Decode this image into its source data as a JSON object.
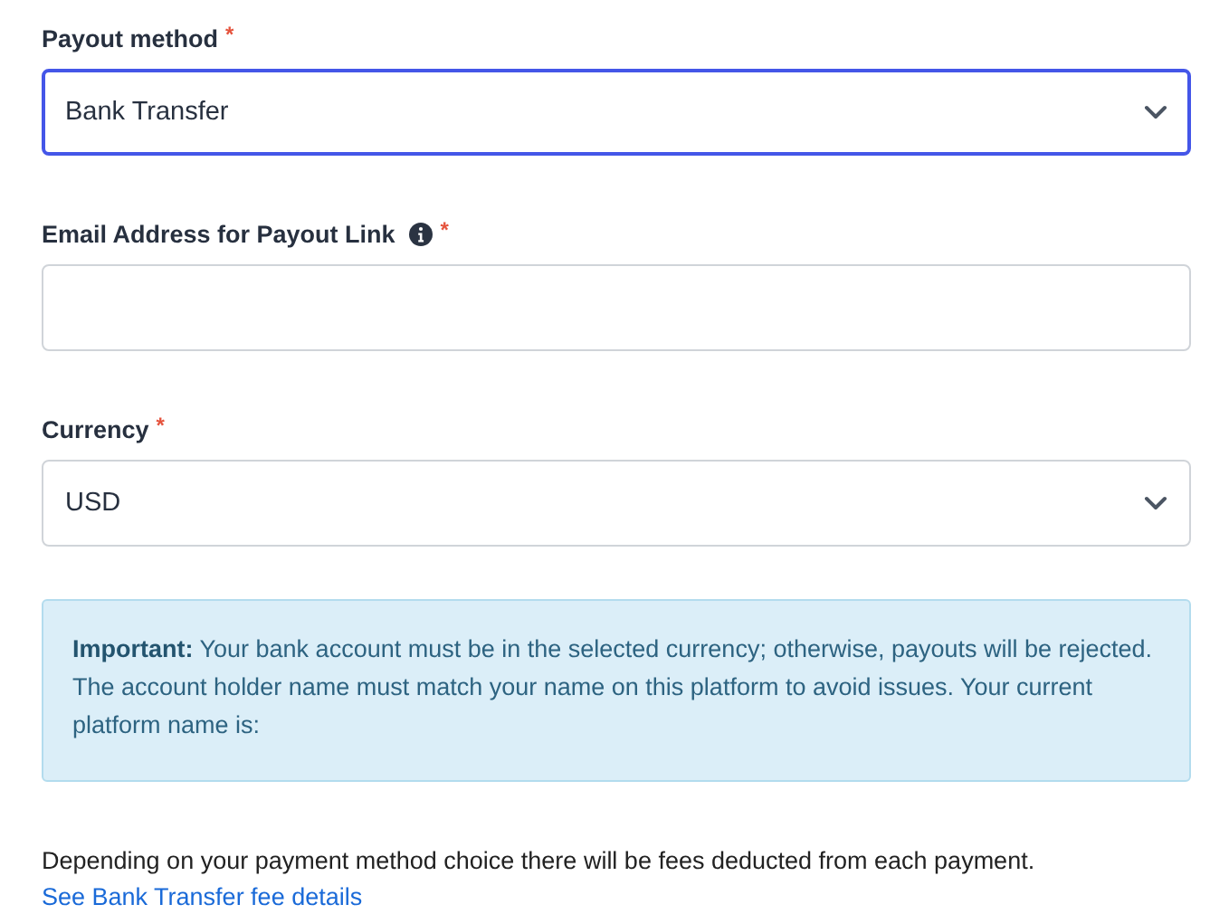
{
  "fields": [
    {
      "kind": "select",
      "label": "Payout method",
      "required_mark": "*",
      "info": false,
      "value": "Bank Transfer",
      "focused": true
    },
    {
      "kind": "text",
      "label": "Email Address for Payout Link",
      "required_mark": "*",
      "info": true,
      "focused": false
    },
    {
      "kind": "select",
      "label": "Currency",
      "required_mark": "*",
      "info": false,
      "value": "USD",
      "focused": false
    }
  ],
  "notice": {
    "text": "**Important:** Your bank account must be in the selected currency; otherwise, payouts will be rejected. The account holder name must match your name on this platform to avoid issues. Your current platform name is:"
  },
  "fees": {
    "text": "Depending on your payment method choice there will be fees deducted from each payment.",
    "link": "See Bank Transfer fee details"
  }
}
